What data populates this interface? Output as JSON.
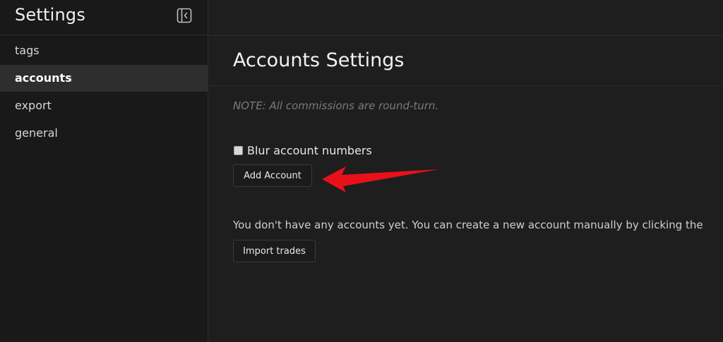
{
  "sidebar": {
    "title": "Settings",
    "collapse_icon": "sidebar-collapse-icon",
    "items": [
      {
        "label": "tags",
        "active": false
      },
      {
        "label": "accounts",
        "active": true
      },
      {
        "label": "export",
        "active": false
      },
      {
        "label": "general",
        "active": false
      }
    ]
  },
  "main": {
    "title": "Accounts Settings",
    "note": "NOTE: All commissions are round-turn.",
    "blur_label": "Blur account numbers",
    "add_account_label": "Add Account",
    "empty_message": "You don't have any accounts yet. You can create a new account manually by clicking the",
    "import_trades_label": "Import trades"
  },
  "annotation": {
    "arrow_color": "#e8101a"
  }
}
